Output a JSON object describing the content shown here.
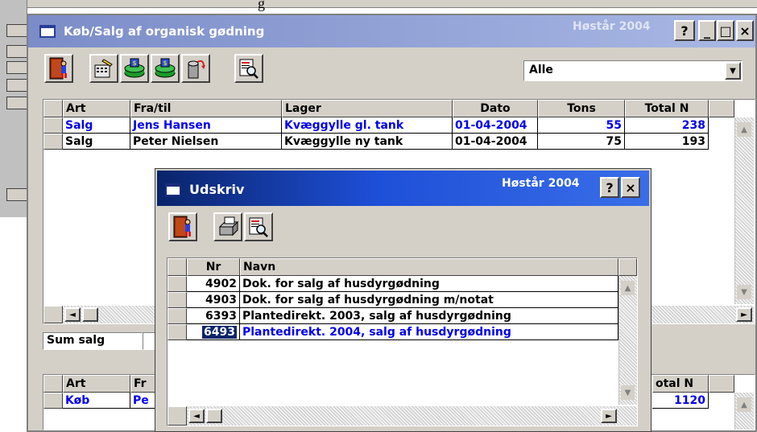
{
  "background": {
    "top_text": "g"
  },
  "main_window": {
    "title": "Køb/Salg af organisk gødning",
    "year": "Høstår 2004",
    "help_label": "?",
    "minimize_label": "_",
    "maximize_label": "□",
    "close_label": "×",
    "filter_value": "Alle",
    "sales_grid": {
      "columns": [
        "Art",
        "Fra/til",
        "Lager",
        "Dato",
        "Tons",
        "Total N"
      ],
      "rows": [
        {
          "art": "Salg",
          "fra_til": "Jens Hansen",
          "lager": "Kvæggylle gl. tank",
          "dato": "01-04-2004",
          "tons": "55",
          "total_n": "238",
          "highlighted": true
        },
        {
          "art": "Salg",
          "fra_til": "Peter Nielsen",
          "lager": "Kvæggylle ny tank",
          "dato": "01-04-2004",
          "tons": "75",
          "total_n": "193",
          "highlighted": false
        }
      ]
    },
    "sum_label": "Sum salg",
    "purchase_grid": {
      "columns": [
        "Art",
        "Fr",
        "otal N"
      ],
      "rows": [
        {
          "art": "Køb",
          "fra_til": "Pe",
          "total_n": "1120"
        }
      ]
    }
  },
  "print_dialog": {
    "title": "Udskriv",
    "year": "Høstår 2004",
    "help_label": "?",
    "close_label": "×",
    "columns": [
      "Nr",
      "Navn"
    ],
    "rows": [
      {
        "nr": "4902",
        "navn": "Dok. for salg af husdyrgødning",
        "selected": false
      },
      {
        "nr": "4903",
        "navn": "Dok. for salg af husdyrgødning m/notat",
        "selected": false
      },
      {
        "nr": "6393",
        "navn": "Plantedirekt. 2003, salg af husdyrgødning",
        "selected": false
      },
      {
        "nr": "6493",
        "navn": "Plantedirekt. 2004, salg af husdyrgødning",
        "selected": true
      }
    ]
  },
  "colors": {
    "selection_blue": "#0000ee",
    "active_title": "#0a246a",
    "inactive_title": "#7b8cc8"
  }
}
